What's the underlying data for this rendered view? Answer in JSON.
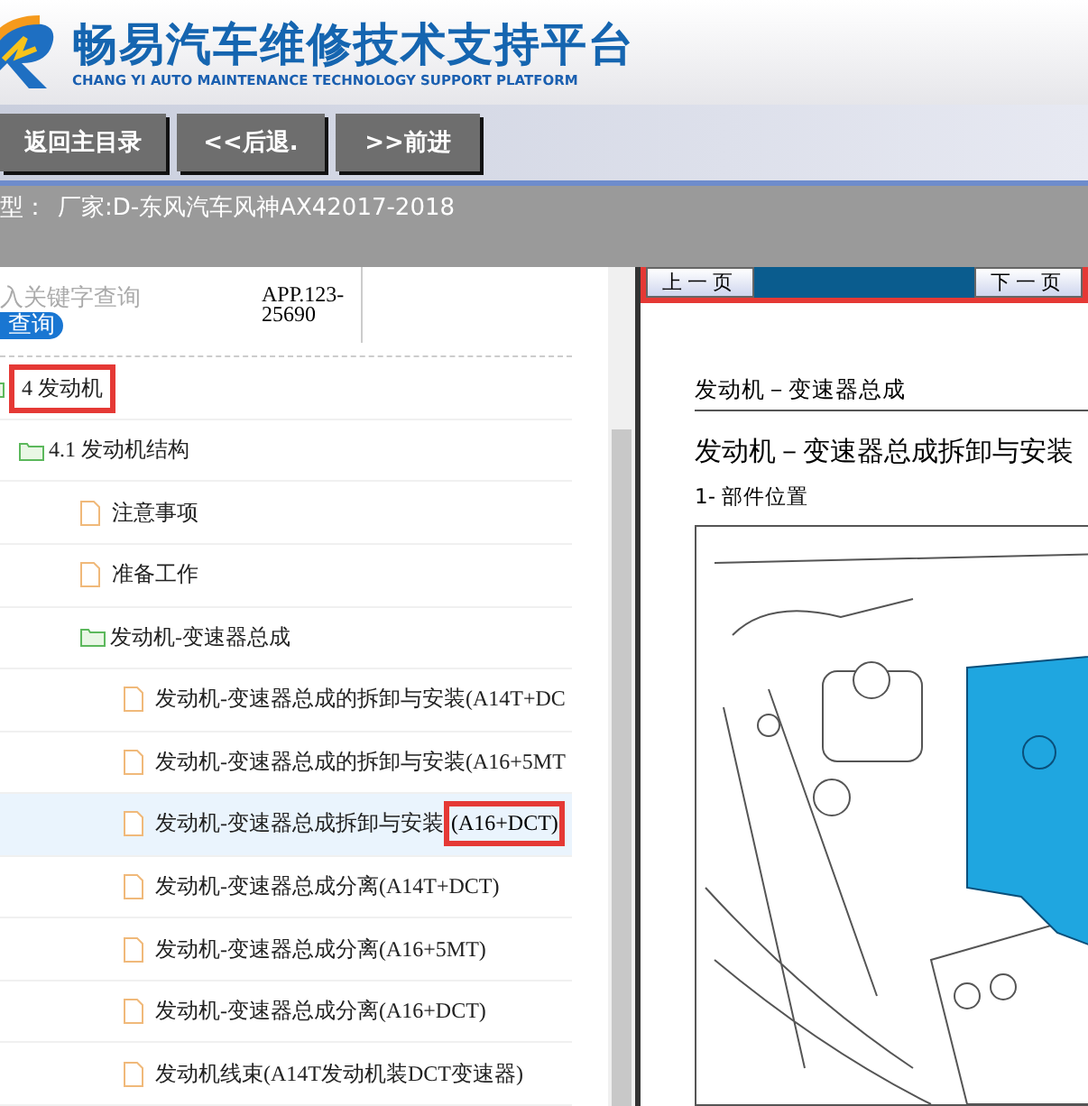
{
  "header": {
    "title": "畅易汽车维修技术支持平台",
    "subtitle": "CHANG YI AUTO MAINTENANCE TECHNOLOGY SUPPORT PLATFORM"
  },
  "toolbar": {
    "buttons": [
      "返回主目录",
      "<<后退.",
      ">>前进"
    ]
  },
  "vehicle_bar": {
    "label": "型：",
    "value": "厂家:D-东风汽车风神AX42017-2018"
  },
  "search": {
    "placeholder": "入关键字查询",
    "button": "查询",
    "app_code": "APP.123-25690"
  },
  "tree": [
    {
      "label": "4 发动机",
      "kind": "folder",
      "highlighted": true,
      "selected": false,
      "children": [
        {
          "label": "4.1 发动机结构",
          "kind": "folder",
          "highlighted": false,
          "selected": false,
          "children": [
            {
              "label": "注意事项",
              "kind": "file",
              "highlighted": false,
              "selected": false
            },
            {
              "label": "准备工作",
              "kind": "file",
              "highlighted": false,
              "selected": false
            },
            {
              "label": "发动机-变速器总成",
              "kind": "folder",
              "highlighted": false,
              "selected": false,
              "children": [
                {
                  "label": "发动机-变速器总成的拆卸与安装(A14T+DC",
                  "kind": "file",
                  "highlighted": false,
                  "selected": false
                },
                {
                  "label": "发动机-变速器总成的拆卸与安装(A16+5MT",
                  "kind": "file",
                  "highlighted": false,
                  "selected": false
                },
                {
                  "label": "发动机-变速器总成拆卸与安装",
                  "highlight_part": "(A16+DCT)",
                  "kind": "file",
                  "highlighted": true,
                  "selected": true
                },
                {
                  "label": "发动机-变速器总成分离(A14T+DCT)",
                  "kind": "file",
                  "highlighted": false,
                  "selected": false
                },
                {
                  "label": "发动机-变速器总成分离(A16+5MT)",
                  "kind": "file",
                  "highlighted": false,
                  "selected": false
                },
                {
                  "label": "发动机-变速器总成分离(A16+DCT)",
                  "kind": "file",
                  "highlighted": false,
                  "selected": false
                },
                {
                  "label": "发动机线束(A14T发动机装DCT变速器)",
                  "kind": "file",
                  "highlighted": false,
                  "selected": false
                }
              ]
            }
          ]
        }
      ]
    }
  ],
  "viewer": {
    "highlighted": true,
    "prev_button": "上一页",
    "next_button": "下一页",
    "section": "发动机－变速器总成",
    "title": "发动机－变速器总成拆卸与安装",
    "subtitle": "1- 部件位置"
  }
}
